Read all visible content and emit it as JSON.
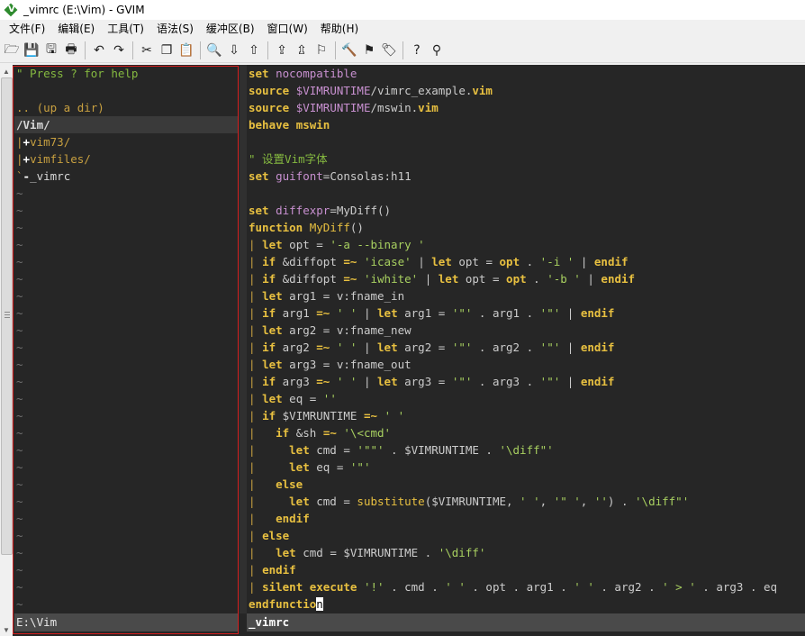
{
  "window": {
    "title": "_vimrc (E:\\Vim) - GVIM"
  },
  "menu": [
    "文件(F)",
    "编辑(E)",
    "工具(T)",
    "语法(S)",
    "缓冲区(B)",
    "窗口(W)",
    "帮助(H)"
  ],
  "toolbar": {
    "groups": [
      [
        {
          "name": "open-icon",
          "glyph": "🗁"
        },
        {
          "name": "save-icon",
          "glyph": "💾"
        },
        {
          "name": "save-all-icon",
          "glyph": "🖫"
        },
        {
          "name": "print-icon",
          "glyph": "🖶"
        }
      ],
      [
        {
          "name": "undo-icon",
          "glyph": "↶"
        },
        {
          "name": "redo-icon",
          "glyph": "↷"
        }
      ],
      [
        {
          "name": "cut-icon",
          "glyph": "✂"
        },
        {
          "name": "copy-icon",
          "glyph": "❐"
        },
        {
          "name": "paste-icon",
          "glyph": "📋"
        }
      ],
      [
        {
          "name": "find-replace-icon",
          "glyph": "🔍"
        },
        {
          "name": "find-next-icon",
          "glyph": "⇩"
        },
        {
          "name": "find-prev-icon",
          "glyph": "⇧"
        }
      ],
      [
        {
          "name": "load-session-icon",
          "glyph": "⇪"
        },
        {
          "name": "save-session-icon",
          "glyph": "⇫"
        },
        {
          "name": "run-script-icon",
          "glyph": "⚐"
        }
      ],
      [
        {
          "name": "make-icon",
          "glyph": "🔨"
        },
        {
          "name": "shell-icon",
          "glyph": "⚑"
        },
        {
          "name": "tag-jump-icon",
          "glyph": "🏷"
        }
      ],
      [
        {
          "name": "help-icon",
          "glyph": "?"
        },
        {
          "name": "find-help-icon",
          "glyph": "⚲"
        }
      ]
    ]
  },
  "tree": {
    "help": "\" Press ? for help",
    "updir": ".. (up a dir)",
    "current_dir": "/Vim/",
    "entries": [
      {
        "branch": "|",
        "marker": "+",
        "name": "vim73/"
      },
      {
        "branch": "|",
        "marker": "+",
        "name": "vimfiles/"
      },
      {
        "branch": "`",
        "marker": "-",
        "name": "_vimrc"
      }
    ],
    "tilde": "~",
    "status": "E:\\Vim"
  },
  "code": {
    "lines": [
      [
        [
          "k",
          "set"
        ],
        [
          "t",
          " "
        ],
        [
          "v",
          "nocompatible"
        ]
      ],
      [
        [
          "k",
          "source"
        ],
        [
          "t",
          " "
        ],
        [
          "v",
          "$VIMRUNTIME"
        ],
        [
          "t",
          "/vimrc_example."
        ],
        [
          "k",
          "vim"
        ]
      ],
      [
        [
          "k",
          "source"
        ],
        [
          "t",
          " "
        ],
        [
          "v",
          "$VIMRUNTIME"
        ],
        [
          "t",
          "/mswin."
        ],
        [
          "k",
          "vim"
        ]
      ],
      [
        [
          "k",
          "behave"
        ],
        [
          "t",
          " "
        ],
        [
          "k",
          "mswin"
        ]
      ],
      [],
      [
        [
          "c",
          "\" 设置Vim字体"
        ]
      ],
      [
        [
          "k",
          "set"
        ],
        [
          "t",
          " "
        ],
        [
          "v",
          "guifont"
        ],
        [
          "t",
          "=Consolas:h11"
        ]
      ],
      [],
      [
        [
          "k",
          "set"
        ],
        [
          "t",
          " "
        ],
        [
          "v",
          "diffexpr"
        ],
        [
          "t",
          "=MyDiff()"
        ]
      ],
      [
        [
          "k",
          "function"
        ],
        [
          "t",
          " "
        ],
        [
          "f",
          "MyDiff"
        ],
        [
          "t",
          "()"
        ]
      ],
      [
        [
          "b",
          "| "
        ],
        [
          "k",
          "let"
        ],
        [
          "t",
          " opt = "
        ],
        [
          "s",
          "'-a --binary '"
        ]
      ],
      [
        [
          "b",
          "| "
        ],
        [
          "k",
          "if"
        ],
        [
          "t",
          " &diffopt "
        ],
        [
          "k",
          "=~"
        ],
        [
          "t",
          " "
        ],
        [
          "s",
          "'icase'"
        ],
        [
          "t",
          " | "
        ],
        [
          "k",
          "let"
        ],
        [
          "t",
          " opt = "
        ],
        [
          "k",
          "opt"
        ],
        [
          "t",
          " . "
        ],
        [
          "s",
          "'-i '"
        ],
        [
          "t",
          " | "
        ],
        [
          "k",
          "endif"
        ]
      ],
      [
        [
          "b",
          "| "
        ],
        [
          "k",
          "if"
        ],
        [
          "t",
          " &diffopt "
        ],
        [
          "k",
          "=~"
        ],
        [
          "t",
          " "
        ],
        [
          "s",
          "'iwhite'"
        ],
        [
          "t",
          " | "
        ],
        [
          "k",
          "let"
        ],
        [
          "t",
          " opt = "
        ],
        [
          "k",
          "opt"
        ],
        [
          "t",
          " . "
        ],
        [
          "s",
          "'-b '"
        ],
        [
          "t",
          " | "
        ],
        [
          "k",
          "endif"
        ]
      ],
      [
        [
          "b",
          "| "
        ],
        [
          "k",
          "let"
        ],
        [
          "t",
          " arg1 = v:fname_in"
        ]
      ],
      [
        [
          "b",
          "| "
        ],
        [
          "k",
          "if"
        ],
        [
          "t",
          " arg1 "
        ],
        [
          "k",
          "=~"
        ],
        [
          "t",
          " "
        ],
        [
          "s",
          "' '"
        ],
        [
          "t",
          " | "
        ],
        [
          "k",
          "let"
        ],
        [
          "t",
          " arg1 = "
        ],
        [
          "s",
          "'\"'"
        ],
        [
          "t",
          " . arg1 . "
        ],
        [
          "s",
          "'\"'"
        ],
        [
          "t",
          " | "
        ],
        [
          "k",
          "endif"
        ]
      ],
      [
        [
          "b",
          "| "
        ],
        [
          "k",
          "let"
        ],
        [
          "t",
          " arg2 = v:fname_new"
        ]
      ],
      [
        [
          "b",
          "| "
        ],
        [
          "k",
          "if"
        ],
        [
          "t",
          " arg2 "
        ],
        [
          "k",
          "=~"
        ],
        [
          "t",
          " "
        ],
        [
          "s",
          "' '"
        ],
        [
          "t",
          " | "
        ],
        [
          "k",
          "let"
        ],
        [
          "t",
          " arg2 = "
        ],
        [
          "s",
          "'\"'"
        ],
        [
          "t",
          " . arg2 . "
        ],
        [
          "s",
          "'\"'"
        ],
        [
          "t",
          " | "
        ],
        [
          "k",
          "endif"
        ]
      ],
      [
        [
          "b",
          "| "
        ],
        [
          "k",
          "let"
        ],
        [
          "t",
          " arg3 = v:fname_out"
        ]
      ],
      [
        [
          "b",
          "| "
        ],
        [
          "k",
          "if"
        ],
        [
          "t",
          " arg3 "
        ],
        [
          "k",
          "=~"
        ],
        [
          "t",
          " "
        ],
        [
          "s",
          "' '"
        ],
        [
          "t",
          " | "
        ],
        [
          "k",
          "let"
        ],
        [
          "t",
          " arg3 = "
        ],
        [
          "s",
          "'\"'"
        ],
        [
          "t",
          " . arg3 . "
        ],
        [
          "s",
          "'\"'"
        ],
        [
          "t",
          " | "
        ],
        [
          "k",
          "endif"
        ]
      ],
      [
        [
          "b",
          "| "
        ],
        [
          "k",
          "let"
        ],
        [
          "t",
          " eq = "
        ],
        [
          "s",
          "''"
        ]
      ],
      [
        [
          "b",
          "| "
        ],
        [
          "k",
          "if"
        ],
        [
          "t",
          " $VIMRUNTIME "
        ],
        [
          "k",
          "=~"
        ],
        [
          "t",
          " "
        ],
        [
          "s",
          "' '"
        ]
      ],
      [
        [
          "b",
          "|   "
        ],
        [
          "k",
          "if"
        ],
        [
          "t",
          " &sh "
        ],
        [
          "k",
          "=~"
        ],
        [
          "t",
          " "
        ],
        [
          "s",
          "'\\<cmd'"
        ]
      ],
      [
        [
          "b",
          "|     "
        ],
        [
          "k",
          "let"
        ],
        [
          "t",
          " cmd = "
        ],
        [
          "s",
          "'\"\"'"
        ],
        [
          "t",
          " . $VIMRUNTIME . "
        ],
        [
          "s",
          "'\\diff\"'"
        ]
      ],
      [
        [
          "b",
          "|     "
        ],
        [
          "k",
          "let"
        ],
        [
          "t",
          " eq = "
        ],
        [
          "s",
          "'\"'"
        ]
      ],
      [
        [
          "b",
          "|   "
        ],
        [
          "k",
          "else"
        ]
      ],
      [
        [
          "b",
          "|     "
        ],
        [
          "k",
          "let"
        ],
        [
          "t",
          " cmd = "
        ],
        [
          "f",
          "substitute"
        ],
        [
          "t",
          "($VIMRUNTIME, "
        ],
        [
          "s",
          "' '"
        ],
        [
          "t",
          ", "
        ],
        [
          "s",
          "'\" '"
        ],
        [
          "t",
          ", "
        ],
        [
          "s",
          "''"
        ],
        [
          "t",
          ") . "
        ],
        [
          "s",
          "'\\diff\"'"
        ]
      ],
      [
        [
          "b",
          "|   "
        ],
        [
          "k",
          "endif"
        ]
      ],
      [
        [
          "b",
          "| "
        ],
        [
          "k",
          "else"
        ]
      ],
      [
        [
          "b",
          "|   "
        ],
        [
          "k",
          "let"
        ],
        [
          "t",
          " cmd = $VIMRUNTIME . "
        ],
        [
          "s",
          "'\\diff'"
        ]
      ],
      [
        [
          "b",
          "| "
        ],
        [
          "k",
          "endif"
        ]
      ],
      [
        [
          "b",
          "| "
        ],
        [
          "k",
          "silent"
        ],
        [
          "t",
          " "
        ],
        [
          "k",
          "execute"
        ],
        [
          "t",
          " "
        ],
        [
          "s",
          "'!'"
        ],
        [
          "t",
          " . cmd . "
        ],
        [
          "s",
          "' '"
        ],
        [
          "t",
          " . opt . arg1 . "
        ],
        [
          "s",
          "' '"
        ],
        [
          "t",
          " . arg2 . "
        ],
        [
          "s",
          "' > '"
        ],
        [
          "t",
          " . arg3 . eq"
        ]
      ],
      [
        [
          "k",
          "endfunctio"
        ],
        [
          "cur",
          "n"
        ]
      ]
    ],
    "status": "_vimrc"
  },
  "colors": {
    "background": "#262626",
    "keyword": "#e8c040",
    "string": "#a8d060",
    "comment": "#85b940",
    "variable": "#c890d0",
    "highlight_box": "#d42020"
  }
}
